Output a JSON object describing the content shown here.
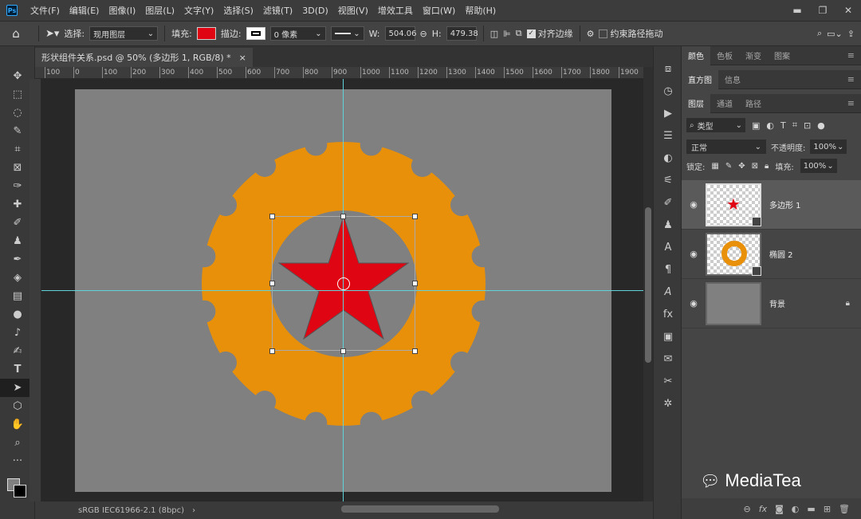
{
  "menubar": {
    "logo": "Ps",
    "items": [
      "文件(F)",
      "编辑(E)",
      "图像(I)",
      "图层(L)",
      "文字(Y)",
      "选择(S)",
      "滤镜(T)",
      "3D(D)",
      "视图(V)",
      "增效工具",
      "窗口(W)",
      "帮助(H)"
    ]
  },
  "options": {
    "select_label": "选择:",
    "select_value": "现用图层",
    "fill_label": "填充:",
    "fill_color": "#e00512",
    "stroke_label": "描边:",
    "stroke_width": "0 像素",
    "w_label": "W:",
    "w_value": "504.06",
    "h_label": "H:",
    "h_value": "479.38",
    "align_edges": "对齐边缘",
    "constrain_path": "约束路径拖动"
  },
  "document": {
    "tab_title": "形状组件关系.psd @ 50% (多边形 1, RGB/8) *",
    "close": "×"
  },
  "ruler": {
    "h_labels": [
      "100",
      "0",
      "100",
      "200",
      "300",
      "400",
      "500",
      "600",
      "700",
      "800",
      "900",
      "1000",
      "1100",
      "1200",
      "1300",
      "1400",
      "1500",
      "1600",
      "1700",
      "1800",
      "1900"
    ]
  },
  "status": {
    "profile": "sRGB IEC61966-2.1 (8bpc)",
    "arrow": "›"
  },
  "canvas": {
    "gear_color": "#e8900a",
    "star_color": "#e00512",
    "circle_color": "#808080",
    "guide_color": "#5fd3d9"
  },
  "panels": {
    "group1": [
      "颜色",
      "色板",
      "渐变",
      "图案"
    ],
    "group2": [
      "直方图",
      "信息"
    ],
    "group3": [
      "图层",
      "通道",
      "路径"
    ],
    "filter_kind": "类型",
    "blend_mode": "正常",
    "opacity_label": "不透明度:",
    "opacity_value": "100%",
    "lock_label": "锁定:",
    "fill_label": "填充:",
    "fill_value": "100%",
    "layers": [
      {
        "name": "多边形 1"
      },
      {
        "name": "椭圆 2"
      },
      {
        "name": "背景"
      }
    ]
  },
  "watermark": "MediaTea"
}
